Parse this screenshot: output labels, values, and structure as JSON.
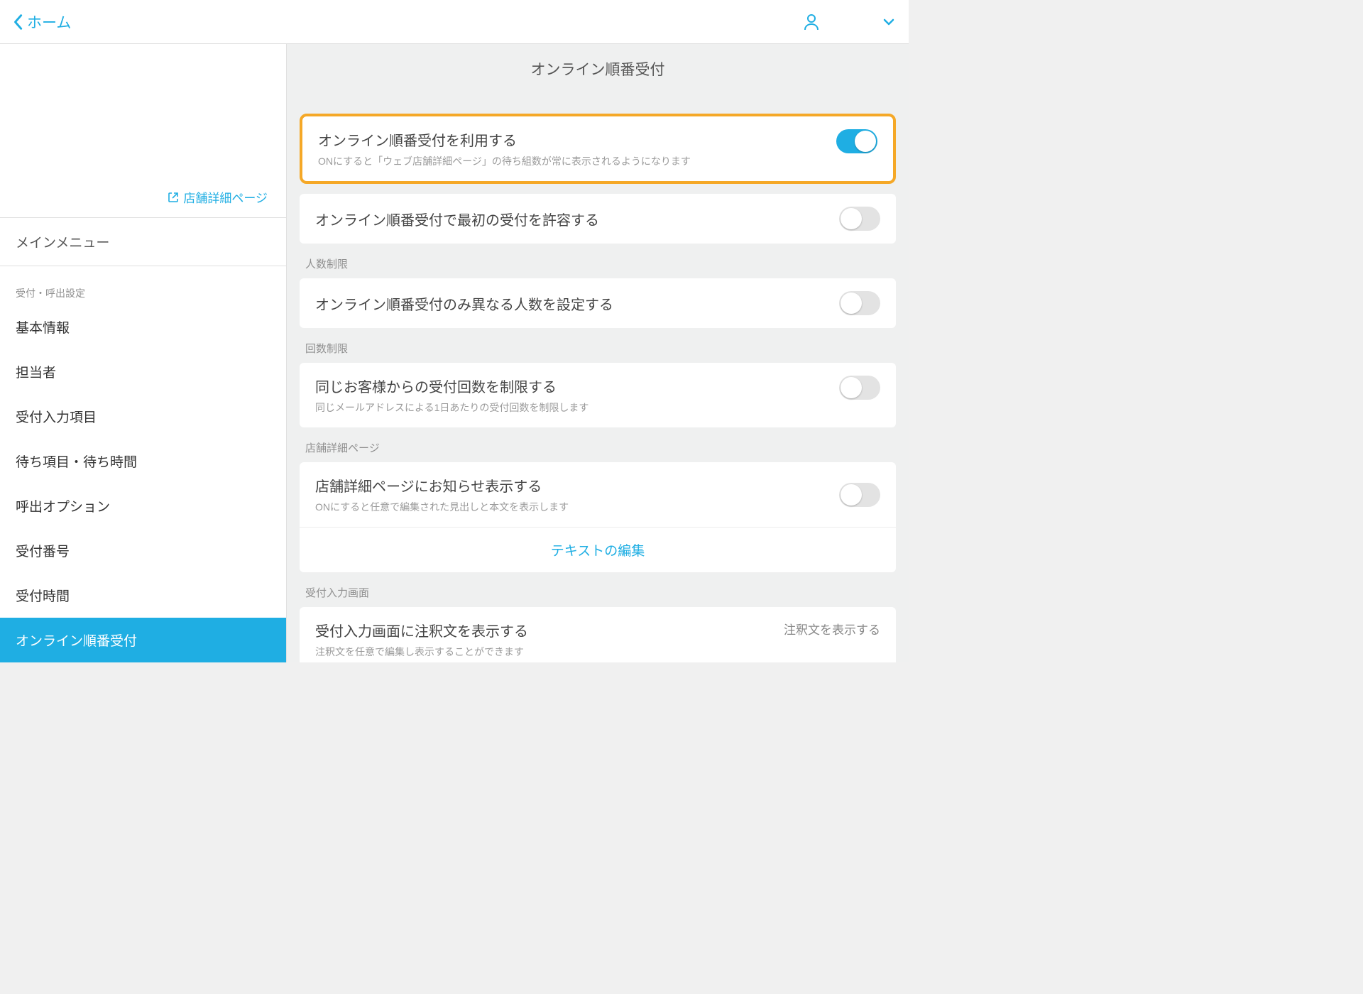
{
  "header": {
    "back_label": "ホーム"
  },
  "sidebar": {
    "store_page_link": "店舗詳細ページ",
    "main_menu": "メインメニュー",
    "section_label": "受付・呼出設定",
    "items": [
      "基本情報",
      "担当者",
      "受付入力項目",
      "待ち項目・待ち時間",
      "呼出オプション",
      "受付番号",
      "受付時間",
      "オンライン順番受付"
    ],
    "active_index": 7
  },
  "main": {
    "title": "オンライン順番受付",
    "s1": {
      "row1_title": "オンライン順番受付を利用する",
      "row1_desc": "ONにすると「ウェブ店舗詳細ページ」の待ち組数が常に表示されるようになります",
      "row1_on": true,
      "row2_title": "オンライン順番受付で最初の受付を許容する",
      "row2_on": false
    },
    "s2": {
      "label": "人数制限",
      "row_title": "オンライン順番受付のみ異なる人数を設定する",
      "row_on": false
    },
    "s3": {
      "label": "回数制限",
      "row_title": "同じお客様からの受付回数を制限する",
      "row_desc": "同じメールアドレスによる1日あたりの受付回数を制限します",
      "row_on": false
    },
    "s4": {
      "label": "店舗詳細ページ",
      "row_title": "店舗詳細ページにお知らせ表示する",
      "row_desc": "ONにすると任意で編集された見出しと本文を表示します",
      "row_on": false,
      "edit_link": "テキストの編集"
    },
    "s5": {
      "label": "受付入力画面",
      "row_title": "受付入力画面に注釈文を表示する",
      "row_desc": "注釈文を任意で編集し表示することができます",
      "right_label": "注釈文を表示する"
    }
  }
}
